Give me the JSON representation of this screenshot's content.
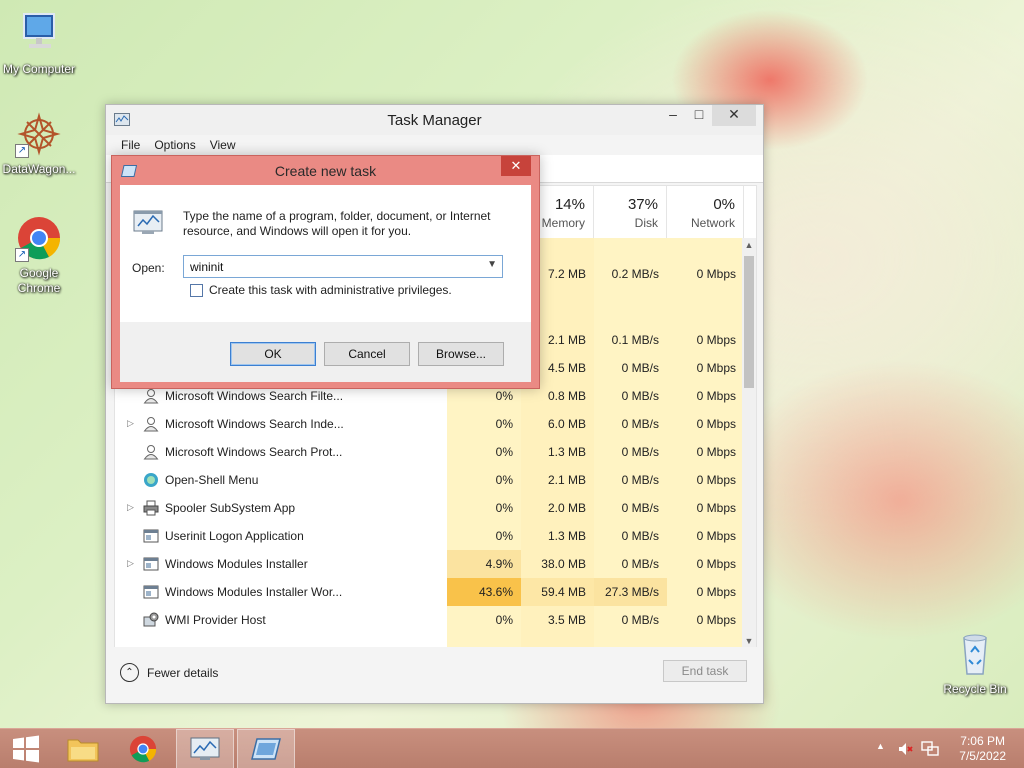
{
  "desktop": {
    "icons": [
      {
        "label": "My Computer"
      },
      {
        "label": "DataWagon..."
      },
      {
        "label": "Google Chrome"
      },
      {
        "label": "Recycle Bin"
      }
    ]
  },
  "task_manager": {
    "title": "Task Manager",
    "menu": [
      "File",
      "Options",
      "View"
    ],
    "columns": {
      "memory": {
        "pct": "14%",
        "label": "Memory"
      },
      "disk": {
        "pct": "37%",
        "label": "Disk"
      },
      "network": {
        "pct": "0%",
        "label": "Network"
      }
    },
    "partial_rows": [
      {
        "memory": "7.2 MB",
        "disk": "0.2 MB/s",
        "network": "0 Mbps"
      },
      {
        "memory": "2.1 MB",
        "disk": "0.1 MB/s",
        "network": "0 Mbps"
      },
      {
        "memory": "4.5 MB",
        "disk": "0 MB/s",
        "network": "0 Mbps"
      }
    ],
    "rows": [
      {
        "name": "Microsoft Windows Search Filte...",
        "cpu": "0%",
        "memory": "0.8 MB",
        "disk": "0 MB/s",
        "network": "0 Mbps",
        "expandable": false
      },
      {
        "name": "Microsoft Windows Search Inde...",
        "cpu": "0%",
        "memory": "6.0 MB",
        "disk": "0 MB/s",
        "network": "0 Mbps",
        "expandable": true
      },
      {
        "name": "Microsoft Windows Search Prot...",
        "cpu": "0%",
        "memory": "1.3 MB",
        "disk": "0 MB/s",
        "network": "0 Mbps",
        "expandable": false
      },
      {
        "name": "Open-Shell Menu",
        "cpu": "0%",
        "memory": "2.1 MB",
        "disk": "0 MB/s",
        "network": "0 Mbps",
        "expandable": false
      },
      {
        "name": "Spooler SubSystem App",
        "cpu": "0%",
        "memory": "2.0 MB",
        "disk": "0 MB/s",
        "network": "0 Mbps",
        "expandable": true
      },
      {
        "name": "Userinit Logon Application",
        "cpu": "0%",
        "memory": "1.3 MB",
        "disk": "0 MB/s",
        "network": "0 Mbps",
        "expandable": false
      },
      {
        "name": "Windows Modules Installer",
        "cpu": "4.9%",
        "memory": "38.0 MB",
        "disk": "0 MB/s",
        "network": "0 Mbps",
        "expandable": true
      },
      {
        "name": "Windows Modules Installer Wor...",
        "cpu": "43.6%",
        "memory": "59.4 MB",
        "disk": "27.3 MB/s",
        "network": "0 Mbps",
        "expandable": false
      },
      {
        "name": "WMI Provider Host",
        "cpu": "0%",
        "memory": "3.5 MB",
        "disk": "0 MB/s",
        "network": "0 Mbps",
        "expandable": false
      }
    ],
    "fewer_details": "Fewer details",
    "end_task": "End task",
    "colors": {
      "cpu_high": "#f9c24a",
      "cpu_med": "#fbe3a0",
      "light": "#fff4c4"
    }
  },
  "dialog": {
    "title": "Create new task",
    "message": "Type the name of a program, folder, document, or Internet resource, and Windows will open it for you.",
    "open_label": "Open:",
    "open_value": "wininit",
    "admin_checkbox": "Create this task with administrative privileges.",
    "ok": "OK",
    "cancel": "Cancel",
    "browse": "Browse..."
  },
  "taskbar": {
    "time": "7:06 PM",
    "date": "7/5/2022"
  }
}
